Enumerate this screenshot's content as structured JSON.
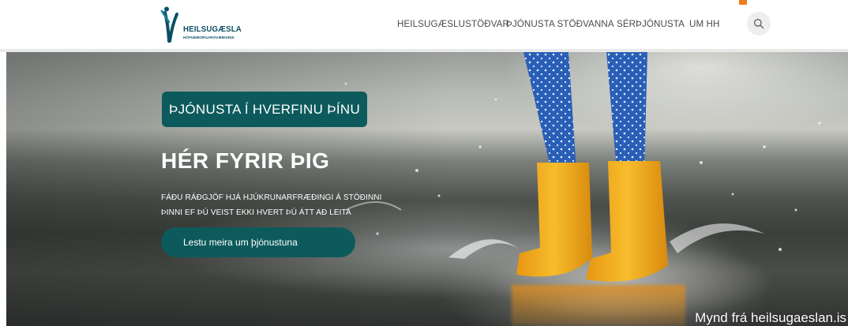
{
  "logo": {
    "name": "HEILSUGÆSLA",
    "tagline": "HÖFUÐBORGARSVÆÐISINS",
    "color": "#0b4f63"
  },
  "nav": {
    "items": [
      "HEILSUGÆSLUSTÖÐVAR",
      "ÞJÓNUSTA STÖÐVANNA",
      "SÉRÞJÓNUSTA",
      "UM HH"
    ],
    "search_icon": "search-icon"
  },
  "hero": {
    "badge": "ÞJÓNUSTA Í HVERFINU ÞÍNU",
    "title": "HÉR FYRIR ÞIG",
    "text_line1": "FÁÐU RÁÐGJÖF HJÁ HJÚKRUNARFRÆÐINGI Á STÖÐINNI",
    "text_line2": "ÞINNI EF ÞÚ VEIST EKKI HVERT ÞÚ ÁTT AÐ LEITA",
    "cta": "Lestu meira um þjónustuna",
    "accent": "#0d5a5c",
    "boot_color": "#f2a91c"
  },
  "caption": "Mynd frá heilsugaeslan.is"
}
